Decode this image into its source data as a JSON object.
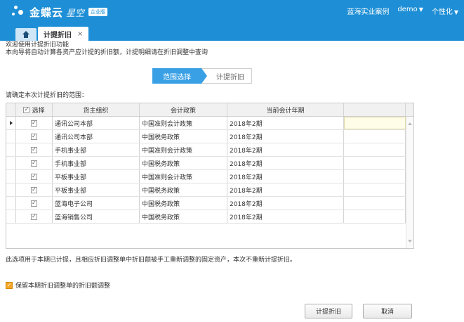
{
  "header": {
    "logo_text": "金蝶云",
    "logo_sub": "星空",
    "logo_badge": "企业版",
    "org": "蓝海实业案例",
    "user": "demo",
    "personalize": "个性化"
  },
  "tabs": {
    "active_label": "计提折旧",
    "close": "×"
  },
  "intro": {
    "line1": "欢迎使用计提折旧功能",
    "line2": "本向导将自动计算各资产应计提的折旧额，计提明细请在折旧调整中查询"
  },
  "steps": {
    "step1": "范围选择",
    "step2": "计提折旧"
  },
  "range_label": "请确定本次计提折旧的范围：",
  "grid": {
    "headers": {
      "select": "选择",
      "org": "货主组织",
      "policy": "会计政策",
      "year": "当前会计年期"
    },
    "rows": [
      {
        "org": "通讯公司本部",
        "policy": "中国准则会计政策",
        "year": "2018年2期"
      },
      {
        "org": "通讯公司本部",
        "policy": "中国税务政策",
        "year": "2018年2期"
      },
      {
        "org": "手机事业部",
        "policy": "中国准则会计政策",
        "year": "2018年2期"
      },
      {
        "org": "手机事业部",
        "policy": "中国税务政策",
        "year": "2018年2期"
      },
      {
        "org": "平板事业部",
        "policy": "中国准则会计政策",
        "year": "2018年2期"
      },
      {
        "org": "平板事业部",
        "policy": "中国税务政策",
        "year": "2018年2期"
      },
      {
        "org": "蓝海电子公司",
        "policy": "中国税务政策",
        "year": "2018年2期"
      },
      {
        "org": "蓝海销售公司",
        "policy": "中国税务政策",
        "year": "2018年2期"
      }
    ]
  },
  "note": "此选项用于本期已计提，且相应折旧调整单中折旧额被手工重新调整的固定资产，本次不重新计提折旧。",
  "keep_option": "保留本期折旧调整单的折旧额调整",
  "buttons": {
    "accrue": "计提折旧",
    "cancel": "取消"
  }
}
